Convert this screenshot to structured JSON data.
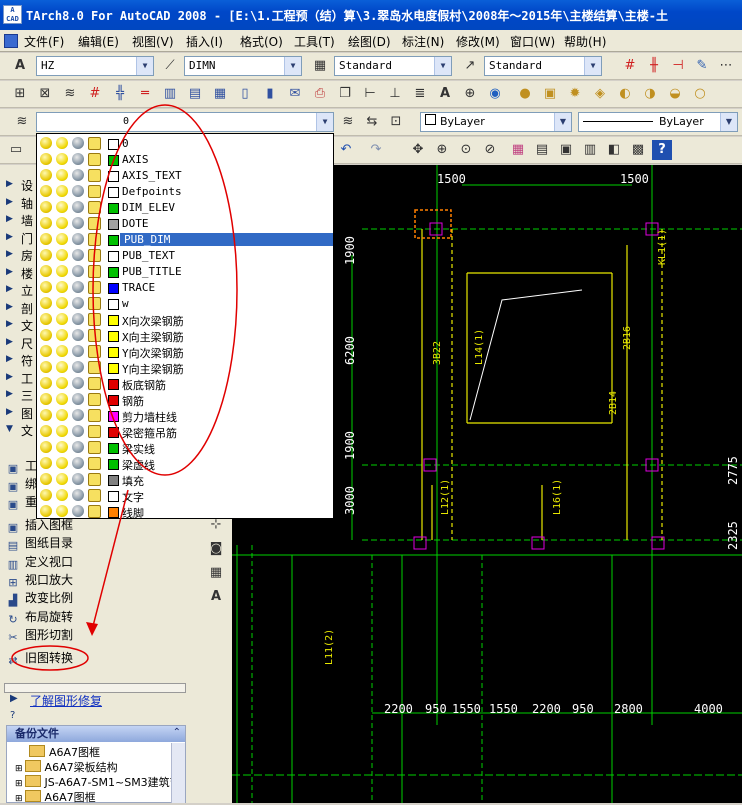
{
  "window": {
    "title": "TArch8.0 For AutoCAD 2008 - [E:\\1.工程预（结）算\\3.翠岛水电度假村\\2008年～2015年\\主楼结算\\主楼-土",
    "icon_text": "AutoCAD"
  },
  "menus": [
    "文件(F)",
    "编辑(E)",
    "视图(V)",
    "插入(I)",
    "格式(O)",
    "工具(T)",
    "绘图(D)",
    "标注(N)",
    "修改(M)",
    "窗口(W)",
    "帮助(H)"
  ],
  "toolbar_styles": {
    "text_style": "HZ",
    "dim_style": "DIMN",
    "table_style": "Standard",
    "multileader_style": "Standard"
  },
  "layer_toolbar": {
    "current_layer": "0",
    "color": "ByLayer",
    "linetype": "ByLayer"
  },
  "layers": [
    {
      "name": "0",
      "color": "#ffffff"
    },
    {
      "name": "AXIS",
      "color": "#00c000"
    },
    {
      "name": "AXIS_TEXT",
      "color": "#ffffff"
    },
    {
      "name": "Defpoints",
      "color": "#ffffff"
    },
    {
      "name": "DIM_ELEV",
      "color": "#00c000"
    },
    {
      "name": "DOTE",
      "color": "#a0a0a0"
    },
    {
      "name": "PUB_DIM",
      "color": "#00c000"
    },
    {
      "name": "PUB_TEXT",
      "color": "#ffffff"
    },
    {
      "name": "PUB_TITLE",
      "color": "#00c000"
    },
    {
      "name": "TRACE",
      "color": "#0000ff"
    },
    {
      "name": "w",
      "color": "#ffffff"
    },
    {
      "name": "X向次梁钢筋",
      "color": "#ffff00"
    },
    {
      "name": "X向主梁钢筋",
      "color": "#ffff00"
    },
    {
      "name": "Y向次梁钢筋",
      "color": "#ffff00"
    },
    {
      "name": "Y向主梁钢筋",
      "color": "#ffff00"
    },
    {
      "name": "板底钢筋",
      "color": "#e00000"
    },
    {
      "name": "钢筋",
      "color": "#e00000"
    },
    {
      "name": "剪力墙柱线",
      "color": "#ff00ff"
    },
    {
      "name": "梁密箍吊筋",
      "color": "#e00000"
    },
    {
      "name": "梁实线",
      "color": "#00c000"
    },
    {
      "name": "梁虚线",
      "color": "#00c000"
    },
    {
      "name": "填充",
      "color": "#808080"
    },
    {
      "name": "文字",
      "color": "#ffffff"
    },
    {
      "name": "线脚",
      "color": "#ff8000"
    }
  ],
  "selected_layer": "PUB_DIM",
  "tarch_menu_collapsed": [
    "设",
    "轴",
    "墙",
    "门",
    "房",
    "楼",
    "立",
    "剖",
    "文",
    "尺",
    "符",
    "工",
    "三",
    "图",
    "文"
  ],
  "tarch_menu_items": [
    {
      "label": "插入图框",
      "icon": "frame-icon"
    },
    {
      "label": "图纸目录",
      "icon": "catalog-icon"
    },
    {
      "label": "定义视口",
      "icon": "viewport-icon"
    },
    {
      "label": "视口放大",
      "icon": "zoom-viewport-icon"
    },
    {
      "label": "改变比例",
      "icon": "scale-icon"
    },
    {
      "label": "布局旋转",
      "icon": "rotate-icon"
    },
    {
      "label": "图形切割",
      "icon": "cut-icon"
    },
    {
      "label": "旧图转换",
      "icon": "convert-icon"
    }
  ],
  "partial_items": [
    "工",
    "绑",
    "重"
  ],
  "help_link": "了解图形修复",
  "backup": {
    "header": "备份文件",
    "files": [
      "A6A7图框",
      "A6A7梁板结构",
      "JS-A6A7-SM1~SM3建筑节",
      "A6A7图框"
    ]
  },
  "drawing": {
    "dims_top": [
      "1500",
      "1500"
    ],
    "dims_left": [
      "1900",
      "6200",
      "1900",
      "3000"
    ],
    "dims_bottom": [
      "2200",
      "950",
      "1550",
      "1550",
      "2200",
      "950",
      "2800",
      "4000"
    ],
    "dims_right": [
      "2775",
      "2325"
    ],
    "beam_labels": [
      "KL1(1)",
      "L14(1)",
      "L16(1)",
      "L12(1)",
      "L11(2)",
      "2B14",
      "2B16",
      "3B22"
    ]
  },
  "colors": {
    "highlight": "#316ac5",
    "annotation": "#e00000",
    "canvas": "#000000"
  }
}
